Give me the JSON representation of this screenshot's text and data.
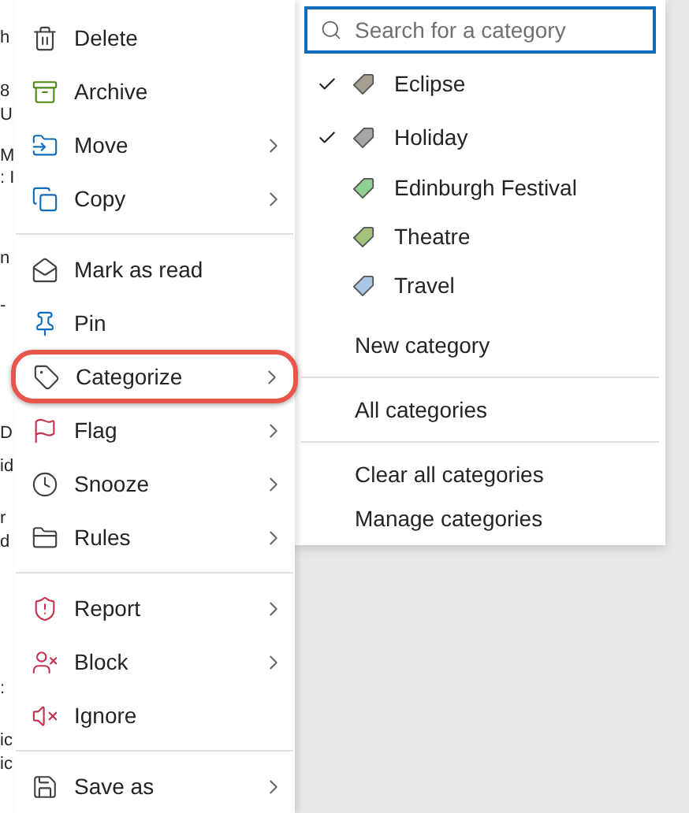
{
  "background_list": {
    "fragments": [
      "h",
      "8",
      "U",
      "M",
      ": I",
      "n",
      "-",
      "D",
      "id",
      "r",
      "d",
      ":",
      "ic",
      "ic"
    ]
  },
  "context_menu": {
    "items": [
      {
        "kind": "command",
        "label": "Delete",
        "submenu": false,
        "highlighted": false
      },
      {
        "kind": "command",
        "label": "Archive",
        "submenu": false,
        "highlighted": false
      },
      {
        "kind": "command",
        "label": "Move",
        "submenu": true,
        "highlighted": false
      },
      {
        "kind": "command",
        "label": "Copy",
        "submenu": true,
        "highlighted": false
      },
      {
        "kind": "separator"
      },
      {
        "kind": "command",
        "label": "Mark as read",
        "submenu": false,
        "highlighted": false
      },
      {
        "kind": "command",
        "label": "Pin",
        "submenu": false,
        "highlighted": false
      },
      {
        "kind": "command",
        "label": "Categorize",
        "submenu": true,
        "highlighted": true
      },
      {
        "kind": "command",
        "label": "Flag",
        "submenu": true,
        "highlighted": false
      },
      {
        "kind": "command",
        "label": "Snooze",
        "submenu": true,
        "highlighted": false
      },
      {
        "kind": "command",
        "label": "Rules",
        "submenu": true,
        "highlighted": false
      },
      {
        "kind": "separator"
      },
      {
        "kind": "command",
        "label": "Report",
        "submenu": true,
        "highlighted": false
      },
      {
        "kind": "command",
        "label": "Block",
        "submenu": true,
        "highlighted": false
      },
      {
        "kind": "command",
        "label": "Ignore",
        "submenu": false,
        "highlighted": false
      },
      {
        "kind": "separator"
      },
      {
        "kind": "command",
        "label": "Save as",
        "submenu": true,
        "highlighted": false
      }
    ]
  },
  "category_menu": {
    "search": {
      "placeholder": "Search for a category"
    },
    "categories": [
      {
        "label": "Eclipse",
        "checked": true,
        "color": "#a89f93"
      },
      {
        "label": "Holiday",
        "checked": true,
        "color": "#a6a6a6"
      },
      {
        "label": "Edinburgh Festival",
        "checked": false,
        "color": "#8fd08f"
      },
      {
        "label": "Theatre",
        "checked": false,
        "color": "#a3c27a"
      },
      {
        "label": "Travel",
        "checked": false,
        "color": "#aac6e6"
      }
    ],
    "actions": [
      {
        "kind": "command",
        "label": "New category"
      },
      {
        "kind": "separator"
      },
      {
        "kind": "command",
        "label": "All categories"
      },
      {
        "kind": "separator"
      },
      {
        "kind": "command",
        "label": "Clear all categories"
      },
      {
        "kind": "command",
        "label": "Manage categories"
      }
    ]
  }
}
